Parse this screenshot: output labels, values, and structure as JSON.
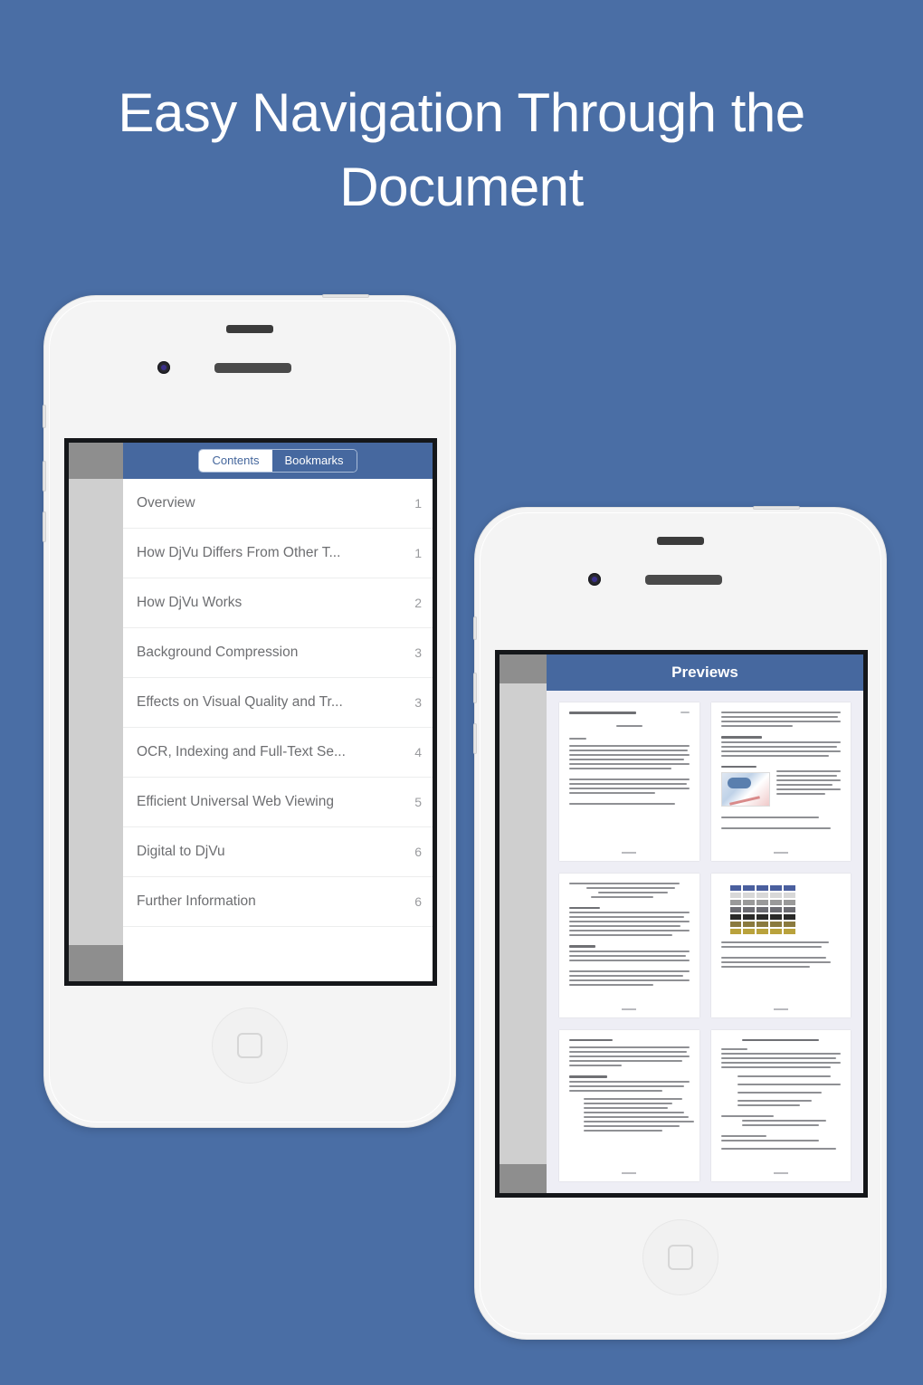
{
  "headline": "Easy Navigation Through the Document",
  "theme": {
    "background": "#4a6ea5",
    "nav_blue": "#46689f",
    "screen_border": "#15171a",
    "text_gray": "#6d6e71",
    "page_number_gray": "#9a9b9e",
    "preview_bg": "#eeeef5"
  },
  "phone_one": {
    "label": "contents-phone",
    "tabs": {
      "contents_label": "Contents",
      "bookmarks_label": "Bookmarks",
      "selected": "Contents"
    },
    "contents": [
      {
        "title": "Overview",
        "page": "1"
      },
      {
        "title": "How DjVu Differs From Other T...",
        "page": "1"
      },
      {
        "title": "How DjVu Works",
        "page": "2"
      },
      {
        "title": "Background Compression",
        "page": "3"
      },
      {
        "title": "Effects on Visual Quality and Tr...",
        "page": "3"
      },
      {
        "title": "OCR, Indexing and Full-Text Se...",
        "page": "4"
      },
      {
        "title": "Efficient Universal Web Viewing",
        "page": "5"
      },
      {
        "title": "Digital to DjVu",
        "page": "6"
      },
      {
        "title": "Further Information",
        "page": "6"
      }
    ]
  },
  "phone_two": {
    "label": "previews-phone",
    "title": "Previews",
    "thumbnails": [
      {
        "name": "page-thumbnail-1",
        "kind": "title-page"
      },
      {
        "name": "page-thumbnail-2",
        "kind": "text-with-figure"
      },
      {
        "name": "page-thumbnail-3",
        "kind": "text-page"
      },
      {
        "name": "page-thumbnail-4",
        "kind": "color-swatch-table"
      },
      {
        "name": "page-thumbnail-5",
        "kind": "text-page"
      },
      {
        "name": "page-thumbnail-6",
        "kind": "text-list-page"
      }
    ]
  },
  "icons": {
    "front_camera": "camera-icon",
    "proximity_sensor": "sensor-icon",
    "earpiece_speaker": "speaker-icon",
    "home_button": "home-button-icon"
  }
}
